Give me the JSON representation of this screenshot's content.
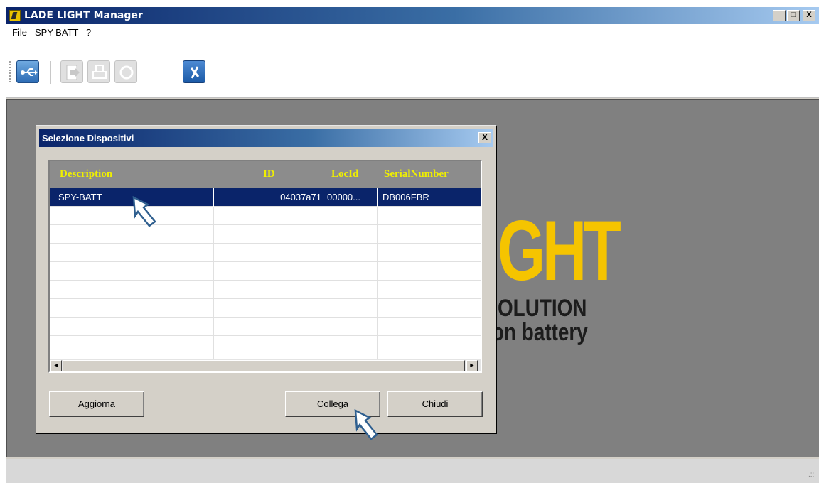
{
  "window": {
    "title": "LADE LIGHT Manager",
    "caption_buttons": {
      "minimize": "_",
      "maximize": "□",
      "close": "X"
    }
  },
  "menu": {
    "items": [
      "File",
      "SPY-BATT",
      "?"
    ]
  },
  "toolbar": {
    "buttons": [
      "usb-connect-icon",
      "export-icon",
      "print-icon",
      "refresh-icon",
      "close-connection-icon"
    ]
  },
  "background_logo": {
    "big": "GHT",
    "line1": "OLUTION",
    "line2": "on battery",
    "accent_color": "#f5c400"
  },
  "dialog": {
    "title": "Selezione Dispositivi",
    "close_label": "X",
    "columns": [
      "Description",
      "ID",
      "LocId",
      "SerialNumber"
    ],
    "rows": [
      {
        "description": "SPY-BATT",
        "id": "04037a71",
        "locid": "00000...",
        "serial": "DB006FBR"
      }
    ],
    "buttons": {
      "refresh": "Aggiorna",
      "connect": "Collega",
      "close": "Chiudi"
    },
    "header_color": "#f0f000",
    "selection_color": "#0a246a"
  },
  "scrollbar": {
    "left": "◄",
    "right": "►"
  },
  "status": {
    "grip": ".::"
  }
}
